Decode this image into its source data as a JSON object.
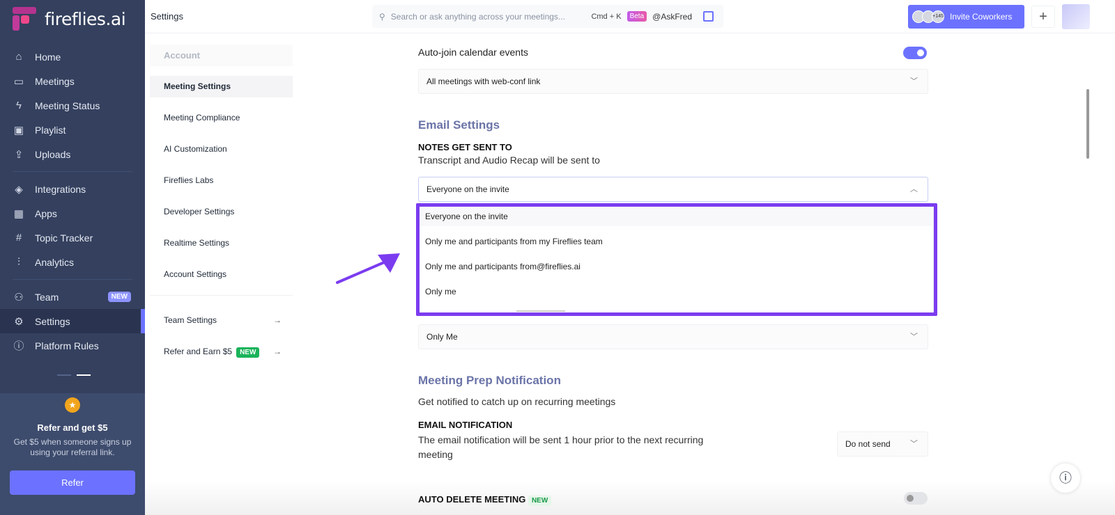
{
  "brand": {
    "name": "fireflies.ai"
  },
  "sidebar": {
    "items": [
      {
        "label": "Home",
        "icon": "⌂"
      },
      {
        "label": "Meetings",
        "icon": "▭"
      },
      {
        "label": "Meeting Status",
        "icon": "ϟ"
      },
      {
        "label": "Playlist",
        "icon": "▣"
      },
      {
        "label": "Uploads",
        "icon": "⇪"
      },
      {
        "label": "Integrations",
        "icon": "◈"
      },
      {
        "label": "Apps",
        "icon": "▦"
      },
      {
        "label": "Topic Tracker",
        "icon": "#"
      },
      {
        "label": "Analytics",
        "icon": "⫶"
      },
      {
        "label": "Team",
        "icon": "⚇",
        "badge": "NEW"
      },
      {
        "label": "Settings",
        "icon": "⚙"
      },
      {
        "label": "Platform Rules",
        "icon": "ⓘ"
      }
    ],
    "refer": {
      "title": "Refer and get $5",
      "text": "Get $5 when someone signs up using your referral link.",
      "button": "Refer"
    }
  },
  "topbar": {
    "title": "Settings",
    "search_placeholder": "Search or ask anything across your meetings...",
    "shortcut": "Cmd + K",
    "beta": "Beta",
    "askfred": "@AskFred",
    "avatar_count": "+145",
    "invite": "Invite Coworkers"
  },
  "subnav": {
    "header": "Account",
    "items": [
      "Meeting Settings",
      "Meeting Compliance",
      "AI Customization",
      "Fireflies Labs",
      "Developer Settings",
      "Realtime Settings",
      "Account Settings"
    ],
    "team": "Team Settings",
    "refer": "Refer and Earn $5",
    "refer_badge": "NEW"
  },
  "main": {
    "autojoin": {
      "label": "Auto-join calendar events",
      "enabled": true
    },
    "autojoin_select": "All meetings with web-conf link",
    "email_settings": "Email Settings",
    "notes_sent_to": "NOTES GET SENT TO",
    "notes_desc": "Transcript and Audio Recap will be sent to",
    "notes_select": "Everyone on the invite",
    "options": [
      "Everyone on the invite",
      "Only me and participants from my Fireflies team",
      "Only me and participants from@fireflies.ai",
      "Only me"
    ],
    "second_select": "Only Me",
    "prep": "Meeting Prep Notification",
    "prep_desc": "Get notified to catch up on recurring meetings",
    "email_notif": "EMAIL NOTIFICATION",
    "email_notif_desc": "The email notification will be sent 1 hour prior to the next recurring meeting",
    "email_notif_select": "Do not send",
    "auto_delete": "AUTO DELETE MEETING",
    "auto_delete_badge": "NEW",
    "auto_delete_enabled": false
  },
  "colors": {
    "accent": "#6c72ff",
    "highlight": "#7b3cf0",
    "sidebar": "#34405e"
  }
}
